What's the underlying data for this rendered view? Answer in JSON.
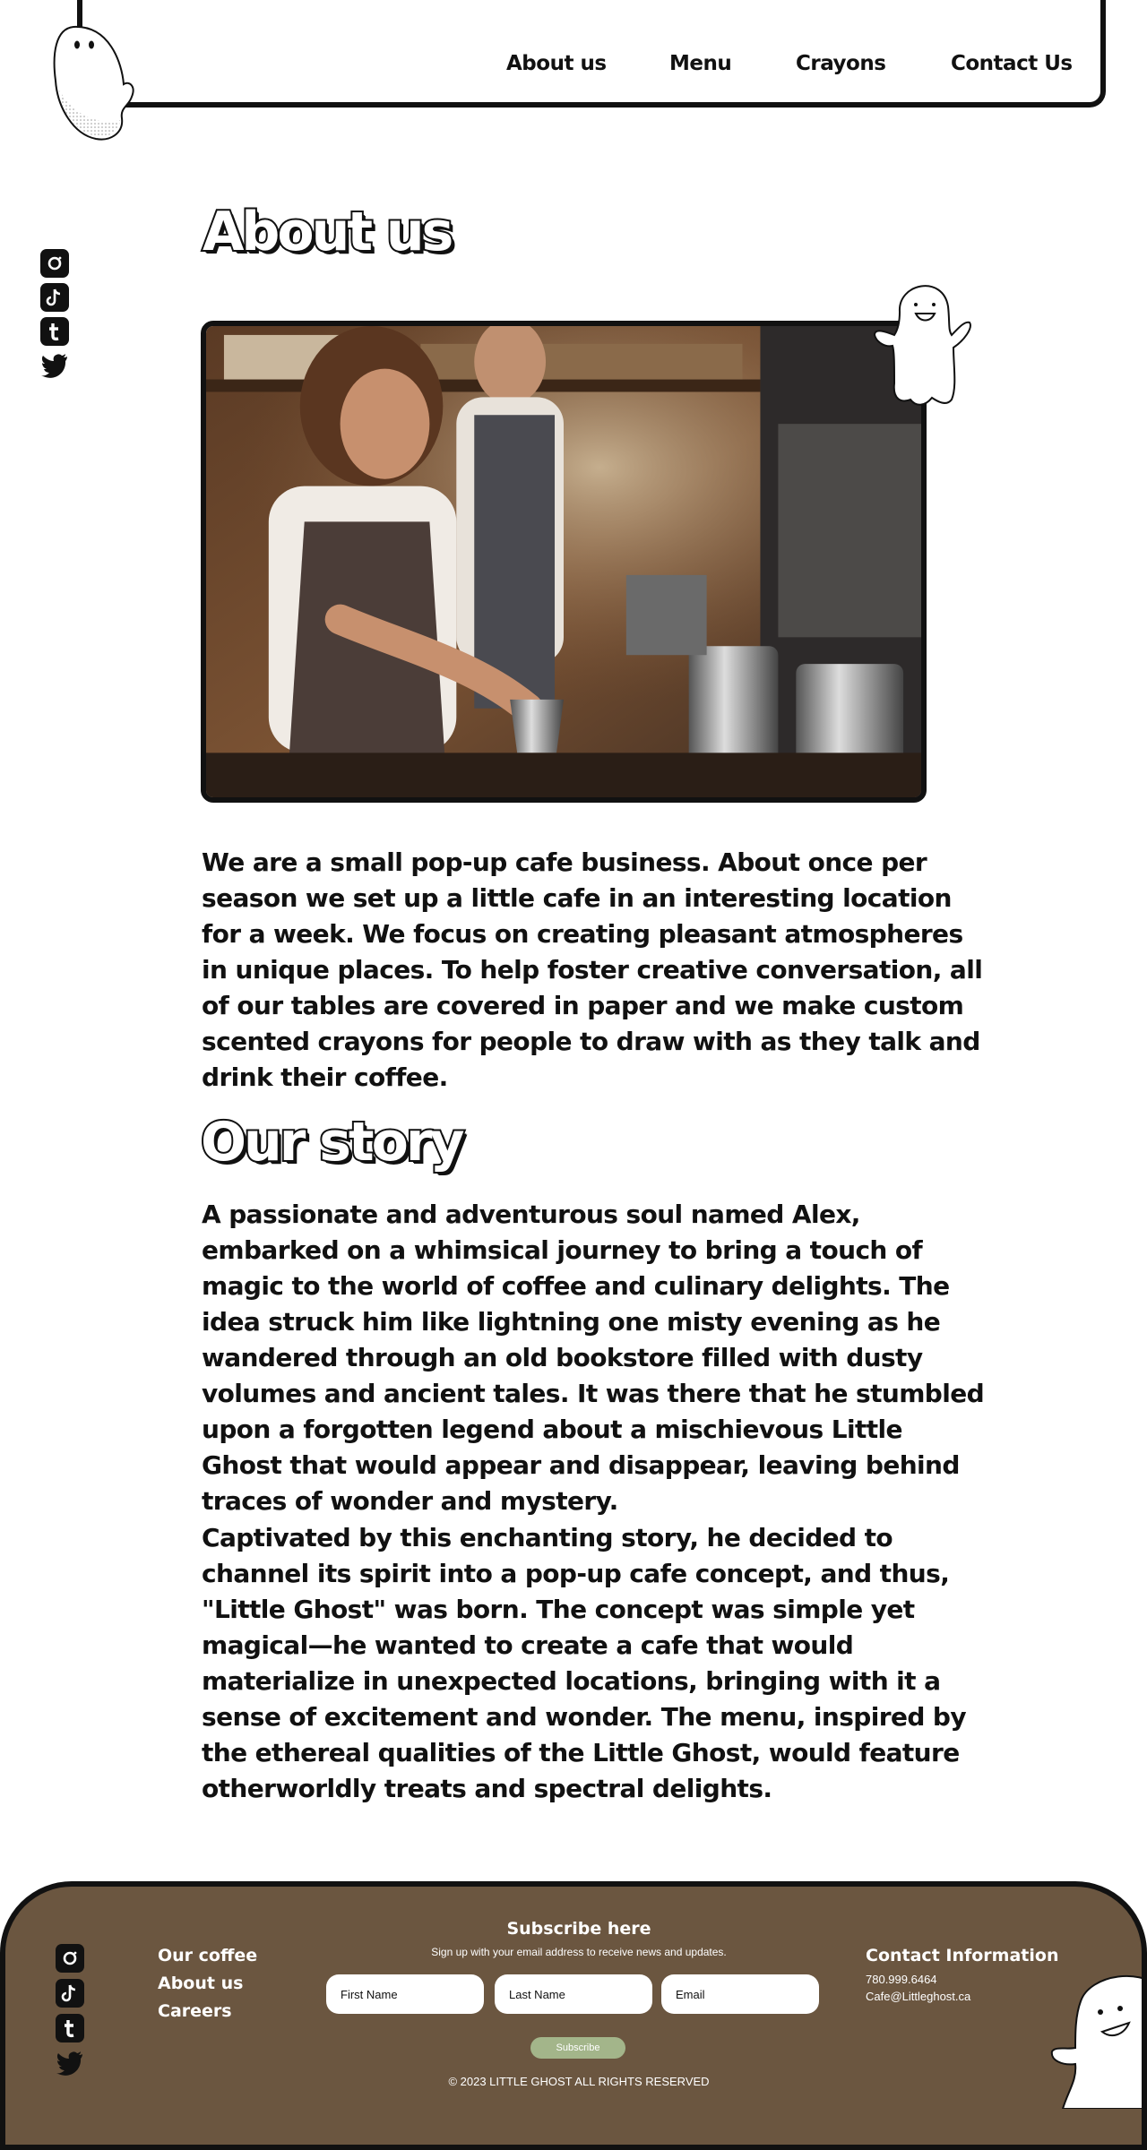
{
  "nav": {
    "items": [
      "About us",
      "Menu",
      "Crayons",
      "Contact Us"
    ]
  },
  "social": {
    "icons": [
      "instagram-icon",
      "tiktok-icon",
      "tumblr-icon",
      "twitter-icon"
    ]
  },
  "about": {
    "heading": "About us",
    "paragraph": "We are a small pop-up cafe business. About once per season we set up a little cafe in an interesting location for a week. We focus on creating pleasant atmospheres in unique places. To help foster creative conversation, all of our tables are covered in paper and we make custom scented crayons for people to draw with as they talk and drink their coffee."
  },
  "story": {
    "heading": "Our story",
    "paragraph1": "A passionate and adventurous soul named Alex, embarked on a whimsical journey to bring a touch of magic to the world of coffee and culinary delights. The idea struck him like lightning one misty evening as he wandered through an old bookstore filled with dusty volumes and ancient tales. It was there that he stumbled upon a forgotten legend about a mischievous Little Ghost that would appear and disappear, leaving behind traces of wonder and mystery.",
    "paragraph2": "Captivated by this enchanting story, he decided to channel its spirit into a pop-up cafe concept, and thus, \"Little Ghost\" was born. The concept was simple yet magical—he wanted to create a cafe that would materialize in unexpected locations, bringing with it a sense of excitement and wonder. The menu, inspired by the ethereal qualities of the Little Ghost, would feature otherworldly treats and spectral delights."
  },
  "footer": {
    "links": [
      "Our coffee",
      "About us",
      "Careers"
    ],
    "subscribe": {
      "title": "Subscribe here",
      "text": "Sign up with your email address to receive news and updates.",
      "first_name_placeholder": "First Name",
      "last_name_placeholder": "Last Name",
      "email_placeholder": "Email",
      "button": "Subscribe"
    },
    "contact": {
      "title": "Contact Information",
      "phone": "780.999.6464",
      "email": "Cafe@Littleghost.ca"
    },
    "copyright": "© 2023 LITTLE GHOST ALL RIGHTS RESERVED"
  },
  "colors": {
    "footer_bg": "#6b5640",
    "subscribe_button": "#a3b58a",
    "ink": "#111111"
  }
}
